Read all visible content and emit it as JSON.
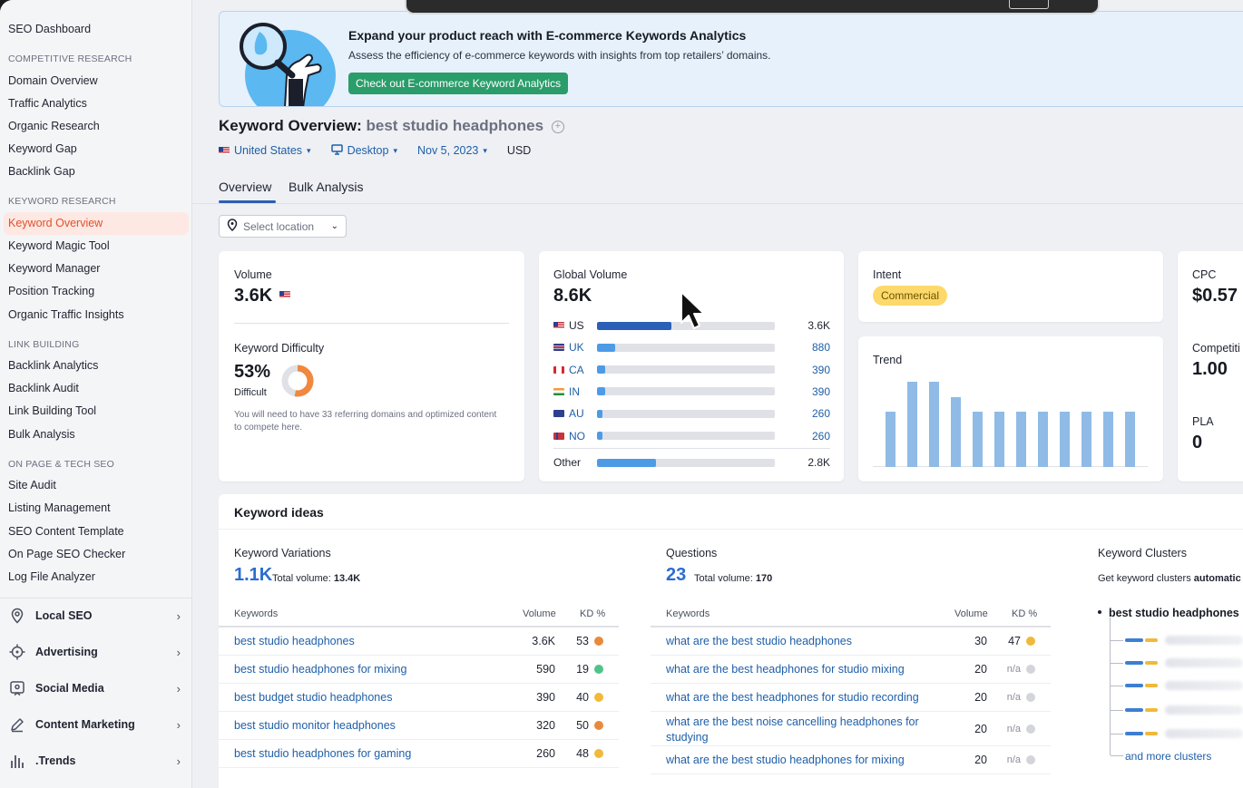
{
  "sidebar": {
    "top_item": "SEO Dashboard",
    "sections": [
      {
        "title": "COMPETITIVE RESEARCH",
        "items": [
          "Domain Overview",
          "Traffic Analytics",
          "Organic Research",
          "Keyword Gap",
          "Backlink Gap"
        ]
      },
      {
        "title": "KEYWORD RESEARCH",
        "items": [
          "Keyword Overview",
          "Keyword Magic Tool",
          "Keyword Manager",
          "Position Tracking",
          "Organic Traffic Insights"
        ]
      },
      {
        "title": "LINK BUILDING",
        "items": [
          "Backlink Analytics",
          "Backlink Audit",
          "Link Building Tool",
          "Bulk Analysis"
        ]
      },
      {
        "title": "ON PAGE & TECH SEO",
        "items": [
          "Site Audit",
          "Listing Management",
          "SEO Content Template",
          "On Page SEO Checker",
          "Log File Analyzer"
        ]
      }
    ],
    "active_item": "Keyword Overview",
    "groups": [
      {
        "label": "Local SEO",
        "icon": "location-pin-icon"
      },
      {
        "label": "Advertising",
        "icon": "target-icon"
      },
      {
        "label": "Social Media",
        "icon": "social-icon"
      },
      {
        "label": "Content Marketing",
        "icon": "pen-icon"
      },
      {
        "label": ".Trends",
        "icon": "bar-chart-icon"
      }
    ]
  },
  "banner": {
    "title": "Expand your product reach with E-commerce Keywords Analytics",
    "subtitle": "Assess the efficiency of e-commerce keywords with insights from top retailers’ domains.",
    "button": "Check out E-commerce Keyword Analytics"
  },
  "header": {
    "title_prefix": "Keyword Overview:",
    "keyword": "best studio headphones",
    "country": "United States",
    "device": "Desktop",
    "date": "Nov 5, 2023",
    "currency": "USD"
  },
  "tabs": [
    "Overview",
    "Bulk Analysis"
  ],
  "location_select": {
    "placeholder": "Select location"
  },
  "volume_card": {
    "label": "Volume",
    "value": "3.6K",
    "kd_label": "Keyword Difficulty",
    "kd_value": "53%",
    "kd_percent": 53,
    "kd_level": "Difficult",
    "kd_note": "You will need to have 33 referring domains and optimized content to compete here.",
    "colors": {
      "donut": "#f0883e",
      "donut_track": "#dfe1e6"
    }
  },
  "global_volume": {
    "label": "Global Volume",
    "value": "8.6K",
    "rows": [
      {
        "country": "US",
        "flag": "us",
        "value": "3.6K",
        "fraction": 0.42
      },
      {
        "country": "UK",
        "flag": "uk",
        "value": "880",
        "fraction": 0.1
      },
      {
        "country": "CA",
        "flag": "ca",
        "value": "390",
        "fraction": 0.045
      },
      {
        "country": "IN",
        "flag": "in",
        "value": "390",
        "fraction": 0.045
      },
      {
        "country": "AU",
        "flag": "au",
        "value": "260",
        "fraction": 0.03
      },
      {
        "country": "NO",
        "flag": "no",
        "value": "260",
        "fraction": 0.03
      }
    ],
    "other": {
      "label": "Other",
      "value": "2.8K",
      "fraction": 0.33
    },
    "colors": {
      "primary": "#2c5fb8",
      "secondary": "#4d9be6"
    }
  },
  "intent_card": {
    "label": "Intent",
    "badge": "Commercial"
  },
  "trend_card": {
    "label": "Trend",
    "values": [
      0.64,
      0.98,
      0.98,
      0.8,
      0.64,
      0.64,
      0.64,
      0.64,
      0.64,
      0.64,
      0.64,
      0.64
    ],
    "color": "#8fbbe6"
  },
  "cpc_card": {
    "cpc_label": "CPC",
    "cpc_value": "$0.57",
    "comp_label": "Competiti",
    "comp_value": "1.00",
    "pla_label": "PLA",
    "pla_value": "0"
  },
  "keyword_ideas": {
    "title": "Keyword ideas",
    "variations": {
      "title": "Keyword Variations",
      "count": "1.1K",
      "total_label": "Total volume:",
      "total_value": "13.4K",
      "columns": [
        "Keywords",
        "Volume",
        "KD %"
      ],
      "rows": [
        {
          "keyword": "best studio headphones",
          "volume": "3.6K",
          "kd": "53",
          "dot": "#e88a3c"
        },
        {
          "keyword": "best studio headphones for mixing",
          "volume": "590",
          "kd": "19",
          "dot": "#4fc389"
        },
        {
          "keyword": "best budget studio headphones",
          "volume": "390",
          "kd": "40",
          "dot": "#f0b93a"
        },
        {
          "keyword": "best studio monitor headphones",
          "volume": "320",
          "kd": "50",
          "dot": "#e88a3c"
        },
        {
          "keyword": "best studio headphones for gaming",
          "volume": "260",
          "kd": "48",
          "dot": "#f0b93a"
        }
      ]
    },
    "questions": {
      "title": "Questions",
      "count": "23",
      "total_label": "Total volume:",
      "total_value": "170",
      "columns": [
        "Keywords",
        "Volume",
        "KD %"
      ],
      "rows": [
        {
          "keyword": "what are the best studio headphones",
          "volume": "30",
          "kd": "47",
          "dot": "#f0b93a"
        },
        {
          "keyword": "what are the best headphones for studio mixing",
          "volume": "20",
          "kd": "n/a",
          "dot": "#d3d5da"
        },
        {
          "keyword": "what are the best headphones for studio recording",
          "volume": "20",
          "kd": "n/a",
          "dot": "#d3d5da"
        },
        {
          "keyword": "what are the best noise cancelling headphones for studying",
          "volume": "20",
          "kd": "n/a",
          "dot": "#d3d5da"
        },
        {
          "keyword": "what are the best studio headphones for mixing",
          "volume": "20",
          "kd": "n/a",
          "dot": "#d3d5da"
        }
      ]
    },
    "clusters": {
      "title": "Keyword Clusters",
      "subtitle_prefix": "Get keyword clusters",
      "subtitle_bold": "automatic",
      "root": "best studio headphones",
      "more_link": "and more clusters"
    }
  }
}
